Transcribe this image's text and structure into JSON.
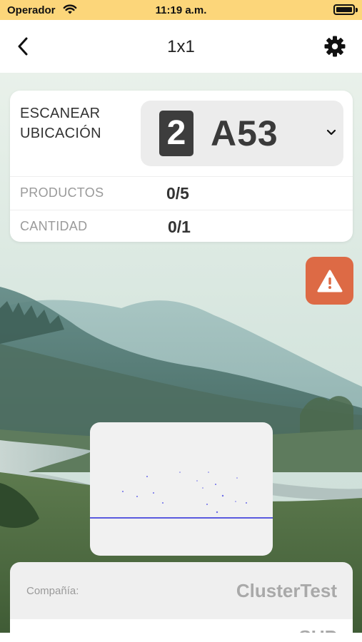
{
  "status_bar": {
    "carrier": "Operador",
    "time": "11:19 a.m."
  },
  "nav": {
    "title": "1x1"
  },
  "scan_card": {
    "label_line1": "ESCANEAR",
    "label_line2": "UBICACIÓN",
    "level": "2",
    "location": "A53",
    "rows": [
      {
        "label": "PRODUCTOS",
        "value": "0/5"
      },
      {
        "label": "CANTIDAD",
        "value": "0/1"
      }
    ]
  },
  "info_panel": {
    "company_label": "Compañía:",
    "company_value": "ClusterTest",
    "row2_value": "SUP"
  },
  "colors": {
    "status_bar_bg": "#fcd67a",
    "alert_button": "#dd6a45",
    "scan_line": "#5a5adf"
  },
  "icons": [
    "wifi-icon",
    "battery-icon",
    "back-chevron-icon",
    "gear-icon",
    "chevron-down-icon",
    "warning-icon"
  ]
}
